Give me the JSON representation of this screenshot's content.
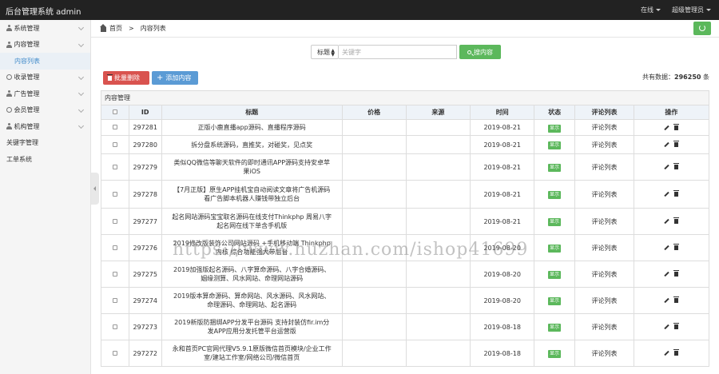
{
  "header": {
    "brand": "后台管理系统  admin",
    "status": "在线",
    "user": "超级管理员"
  },
  "sidebar": {
    "items": [
      {
        "label": "系统管理",
        "icon": "user-icon",
        "expandable": true
      },
      {
        "label": "内容管理",
        "icon": "user-icon",
        "expandable": true
      },
      {
        "label": "内容列表",
        "icon": "",
        "expandable": false,
        "active": true
      },
      {
        "label": "收录管理",
        "icon": "circle-icon",
        "expandable": true
      },
      {
        "label": "广告管理",
        "icon": "user-icon",
        "expandable": true
      },
      {
        "label": "会员管理",
        "icon": "circle-icon",
        "expandable": true
      },
      {
        "label": "机构管理",
        "icon": "user-icon",
        "expandable": true
      },
      {
        "label": "关键字管理",
        "icon": "",
        "expandable": false
      },
      {
        "label": "工单系统",
        "icon": "",
        "expandable": false
      }
    ]
  },
  "breadcrumb": {
    "home": "首页",
    "separator": ">",
    "current": "内容列表"
  },
  "search": {
    "field_select": "标题",
    "placeholder": "关键字",
    "button": "搜内容"
  },
  "actions": {
    "batch_delete": "批量删除",
    "add_content": "添加内容"
  },
  "total": {
    "label": "共有数据：",
    "count": "296250",
    "unit": " 条"
  },
  "panel_title": "内容管理",
  "table": {
    "headers": [
      "",
      "ID",
      "标题",
      "价格",
      "来源",
      "时间",
      "状态",
      "评论列表",
      "操作"
    ],
    "rows": [
      {
        "id": "297281",
        "title": "正版小鹿直播app源码、直播程序源码",
        "price": "",
        "source": "",
        "date": "2019-08-21",
        "status": "显示",
        "comments": "评论列表"
      },
      {
        "id": "297280",
        "title": "拆分盘系统源码，直推奖，对碰奖，见点奖",
        "price": "",
        "source": "",
        "date": "2019-08-21",
        "status": "显示",
        "comments": "评论列表"
      },
      {
        "id": "297279",
        "title": "类似QQ微信等聊天软件的即时通讯APP源码支持安卓苹果iOS",
        "price": "",
        "source": "",
        "date": "2019-08-21",
        "status": "显示",
        "comments": "评论列表"
      },
      {
        "id": "297278",
        "title": "【7月正版】原生APP挂机宝自动阅读文章将广告机源码看广告脚本机器人赚钱带独立后台",
        "price": "",
        "source": "",
        "date": "2019-08-21",
        "status": "显示",
        "comments": "评论列表"
      },
      {
        "id": "297277",
        "title": "起名网站源码宝宝取名源码在线支付Thinkphp 周易八字起名网在线下单含手机版",
        "price": "",
        "source": "",
        "date": "2019-08-21",
        "status": "显示",
        "comments": "评论列表"
      },
      {
        "id": "297276",
        "title": "2019修改版装饰公司网站源码 +手机移动端 Thinkphp内核 综合功能强大带后台",
        "price": "",
        "source": "",
        "date": "2019-08-20",
        "status": "显示",
        "comments": "评论列表"
      },
      {
        "id": "297275",
        "title": "2019加强版起名源码、八字算命源码、八字合婚源码、姻缘测算、风水网站、命理网站源码",
        "price": "",
        "source": "",
        "date": "2019-08-20",
        "status": "显示",
        "comments": "评论列表"
      },
      {
        "id": "297274",
        "title": "2019版本算命源码、算命网站、风水源码、风水网站、命理源码、命理网站、起名源码",
        "price": "",
        "source": "",
        "date": "2019-08-20",
        "status": "显示",
        "comments": "评论列表"
      },
      {
        "id": "297273",
        "title": "2019新版防捆绑APP分发平台源码 支持封装仿fir.im分发APP应用分发托管平台运营版",
        "price": "",
        "source": "",
        "date": "2019-08-18",
        "status": "显示",
        "comments": "评论列表"
      },
      {
        "id": "297272",
        "title": "永和首页PC官网代理V5.9.1原版微信首页模块/企业工作室/建站工作室/网络公司/微信首页",
        "price": "",
        "source": "",
        "date": "2019-08-18",
        "status": "显示",
        "comments": "评论列表"
      }
    ]
  },
  "watermark": "https://www.huzhan.com/ishop41699",
  "colors": {
    "topbar": "#222222",
    "green": "#5cb85c",
    "red": "#d9534f",
    "blue": "#5b9bd5",
    "header_row": "#eef3f8"
  }
}
